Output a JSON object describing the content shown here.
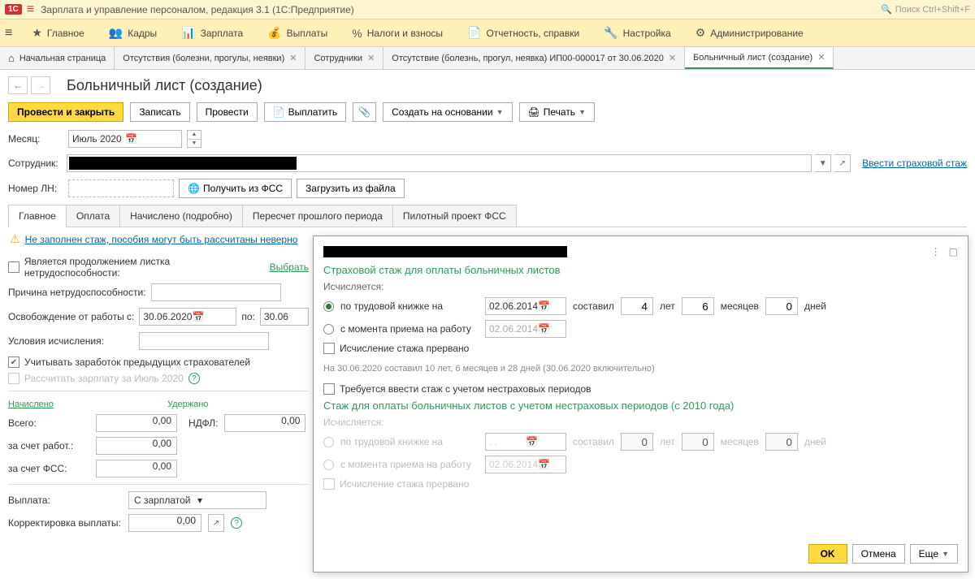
{
  "titlebar": {
    "title": "Зарплата и управление персоналом, редакция 3.1  (1С:Предприятие)",
    "search_placeholder": "Поиск Ctrl+Shift+F"
  },
  "mainmenu": [
    "Главное",
    "Кадры",
    "Зарплата",
    "Выплаты",
    "Налоги и взносы",
    "Отчетность, справки",
    "Настройка",
    "Администрирование"
  ],
  "tabs": {
    "home": "Начальная страница",
    "t1": "Отсутствия (болезни, прогулы, неявки)",
    "t2": "Сотрудники",
    "t3": "Отсутствие (болезнь, прогул, неявка) ИП00-000017 от 30.06.2020",
    "t4": "Больничный лист (создание)"
  },
  "form": {
    "title": "Больничный лист (создание)",
    "btn_primary": "Провести и закрыть",
    "btn_write": "Записать",
    "btn_post": "Провести",
    "btn_pay": "Выплатить",
    "btn_create_based": "Создать на основании",
    "btn_print": "Печать",
    "month_label": "Месяц:",
    "month_value": "Июль 2020",
    "employee_label": "Сотрудник:",
    "link_insurance": "Ввести страховой стаж",
    "ln_label": "Номер ЛН:",
    "btn_fss": "Получить из ФСС",
    "btn_file": "Загрузить из файла"
  },
  "inner_tabs": [
    "Главное",
    "Оплата",
    "Начислено (подробно)",
    "Пересчет прошлого периода",
    "Пилотный проект ФСС"
  ],
  "warn": "Не заполнен стаж, пособия могут быть рассчитаны неверно",
  "main_tab": {
    "continuation": "Является продолжением листка нетрудоспособности:",
    "choose": "Выбрать",
    "reason_label": "Причина нетрудоспособности:",
    "release_label": "Освобождение от работы с:",
    "date_from": "30.06.2020",
    "po": "по:",
    "date_to": "30.06",
    "conditions": "Условия исчисления:",
    "prev_employers": "Учитывать заработок предыдущих страхователей",
    "recalc": "Рассчитать зарплату за Июль 2020",
    "accrued": "Начислено",
    "withheld": "Удержано",
    "total": "Всего:",
    "val0": "0,00",
    "ndfl": "НДФЛ:",
    "by_employer": "за счет работ.:",
    "by_fss": "за счет ФСС:",
    "payment_label": "Выплата:",
    "payment_value": "С зарплатой",
    "correction_label": "Корректировка выплаты:"
  },
  "popup": {
    "sec1_title": "Страховой стаж для оплаты больничных листов",
    "calc": "Исчисляется:",
    "r1": "по трудовой книжке на",
    "d1": "02.06.2014",
    "sostavil": "составил",
    "years": "4",
    "y_label": "лет",
    "months": "6",
    "m_label": "месяцев",
    "days": "0",
    "d_label": "дней",
    "r2": "с момента приема на работу",
    "d2": "02.06.2014",
    "interrupted": "Исчисление стажа прервано",
    "info": "На 30.06.2020 составил 10 лет, 6 месяцев и 28 дней (30.06.2020 включительно)",
    "require_noninsurance": "Требуется ввести стаж с учетом нестраховых периодов",
    "sec2_title": "Стаж для оплаты больничных листов с учетом нестраховых периодов (с 2010 года)",
    "d3_placeholder": "  .  .",
    "y0": "0",
    "m0": "0",
    "dd0": "0",
    "d4": "02.06.2014",
    "ok": "OK",
    "cancel": "Отмена",
    "more": "Еще"
  }
}
